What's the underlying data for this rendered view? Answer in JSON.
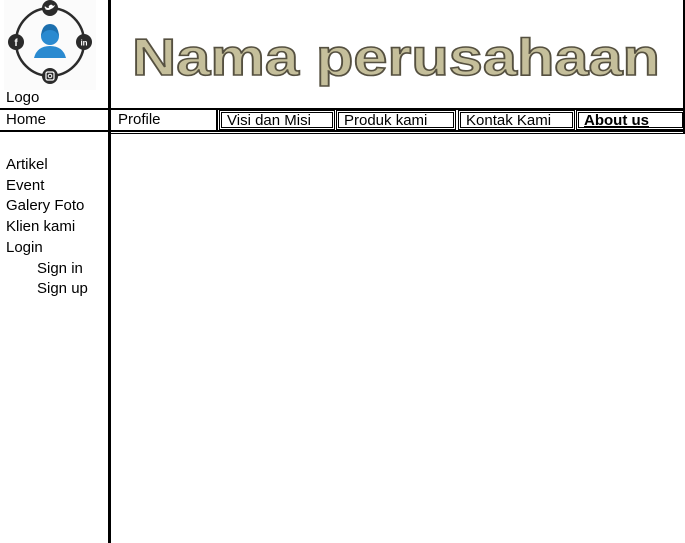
{
  "header": {
    "logo_label": "Logo",
    "company_name": "Nama perusahaan",
    "logo_icons": [
      "twitter-icon",
      "facebook-icon",
      "linkedin-icon",
      "instagram-icon",
      "user-icon"
    ]
  },
  "nav": {
    "home": "Home",
    "tabs": [
      {
        "label": "Profile"
      },
      {
        "label": "Visi dan Misi"
      },
      {
        "label": "Produk kami"
      },
      {
        "label": "Kontak Kami"
      },
      {
        "label": "About us"
      }
    ]
  },
  "sidebar": {
    "items": [
      {
        "label": "Artikel"
      },
      {
        "label": "Event"
      },
      {
        "label": "Galery Foto"
      },
      {
        "label": "Klien kami"
      },
      {
        "label": "Login"
      }
    ],
    "login_sub": [
      {
        "label": "Sign in"
      },
      {
        "label": "Sign up"
      }
    ]
  },
  "colors": {
    "company_name_fill": "#c5bf9b",
    "logo_blue": "#2a8ad0",
    "line": "#000000"
  }
}
